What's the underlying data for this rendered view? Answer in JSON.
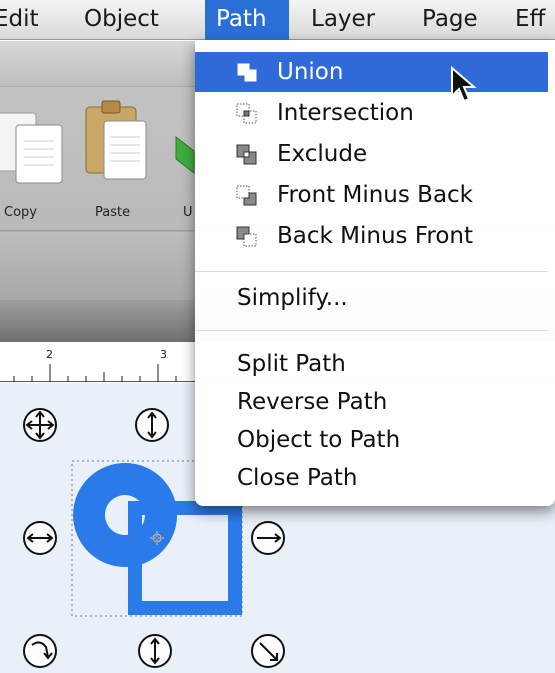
{
  "menubar": {
    "items": [
      {
        "label": "Edit"
      },
      {
        "label": "Object"
      },
      {
        "label": "Path"
      },
      {
        "label": "Layer"
      },
      {
        "label": "Page"
      },
      {
        "label": "Eff"
      }
    ],
    "active_index": 2
  },
  "toolbar": {
    "copy_label": "Copy",
    "paste_label": "Paste"
  },
  "path_menu": {
    "items": [
      {
        "label": "Union",
        "icon": "union-icon",
        "highlighted": true
      },
      {
        "label": "Intersection",
        "icon": "intersection-icon"
      },
      {
        "label": "Exclude",
        "icon": "exclude-icon"
      },
      {
        "label": "Front Minus Back",
        "icon": "front-minus-back-icon"
      },
      {
        "label": "Back Minus Front",
        "icon": "back-minus-front-icon"
      },
      {
        "label": "Simplify..."
      },
      {
        "label": "Split Path"
      },
      {
        "label": "Reverse Path"
      },
      {
        "label": "Object to Path"
      },
      {
        "label": "Close Path"
      }
    ]
  },
  "ruler": {
    "ticks": [
      "2",
      "3"
    ]
  },
  "colors": {
    "accent": "#2f6bd8",
    "shape_blue": "#2a7be9",
    "canvas_bg": "#e9f0f8"
  }
}
